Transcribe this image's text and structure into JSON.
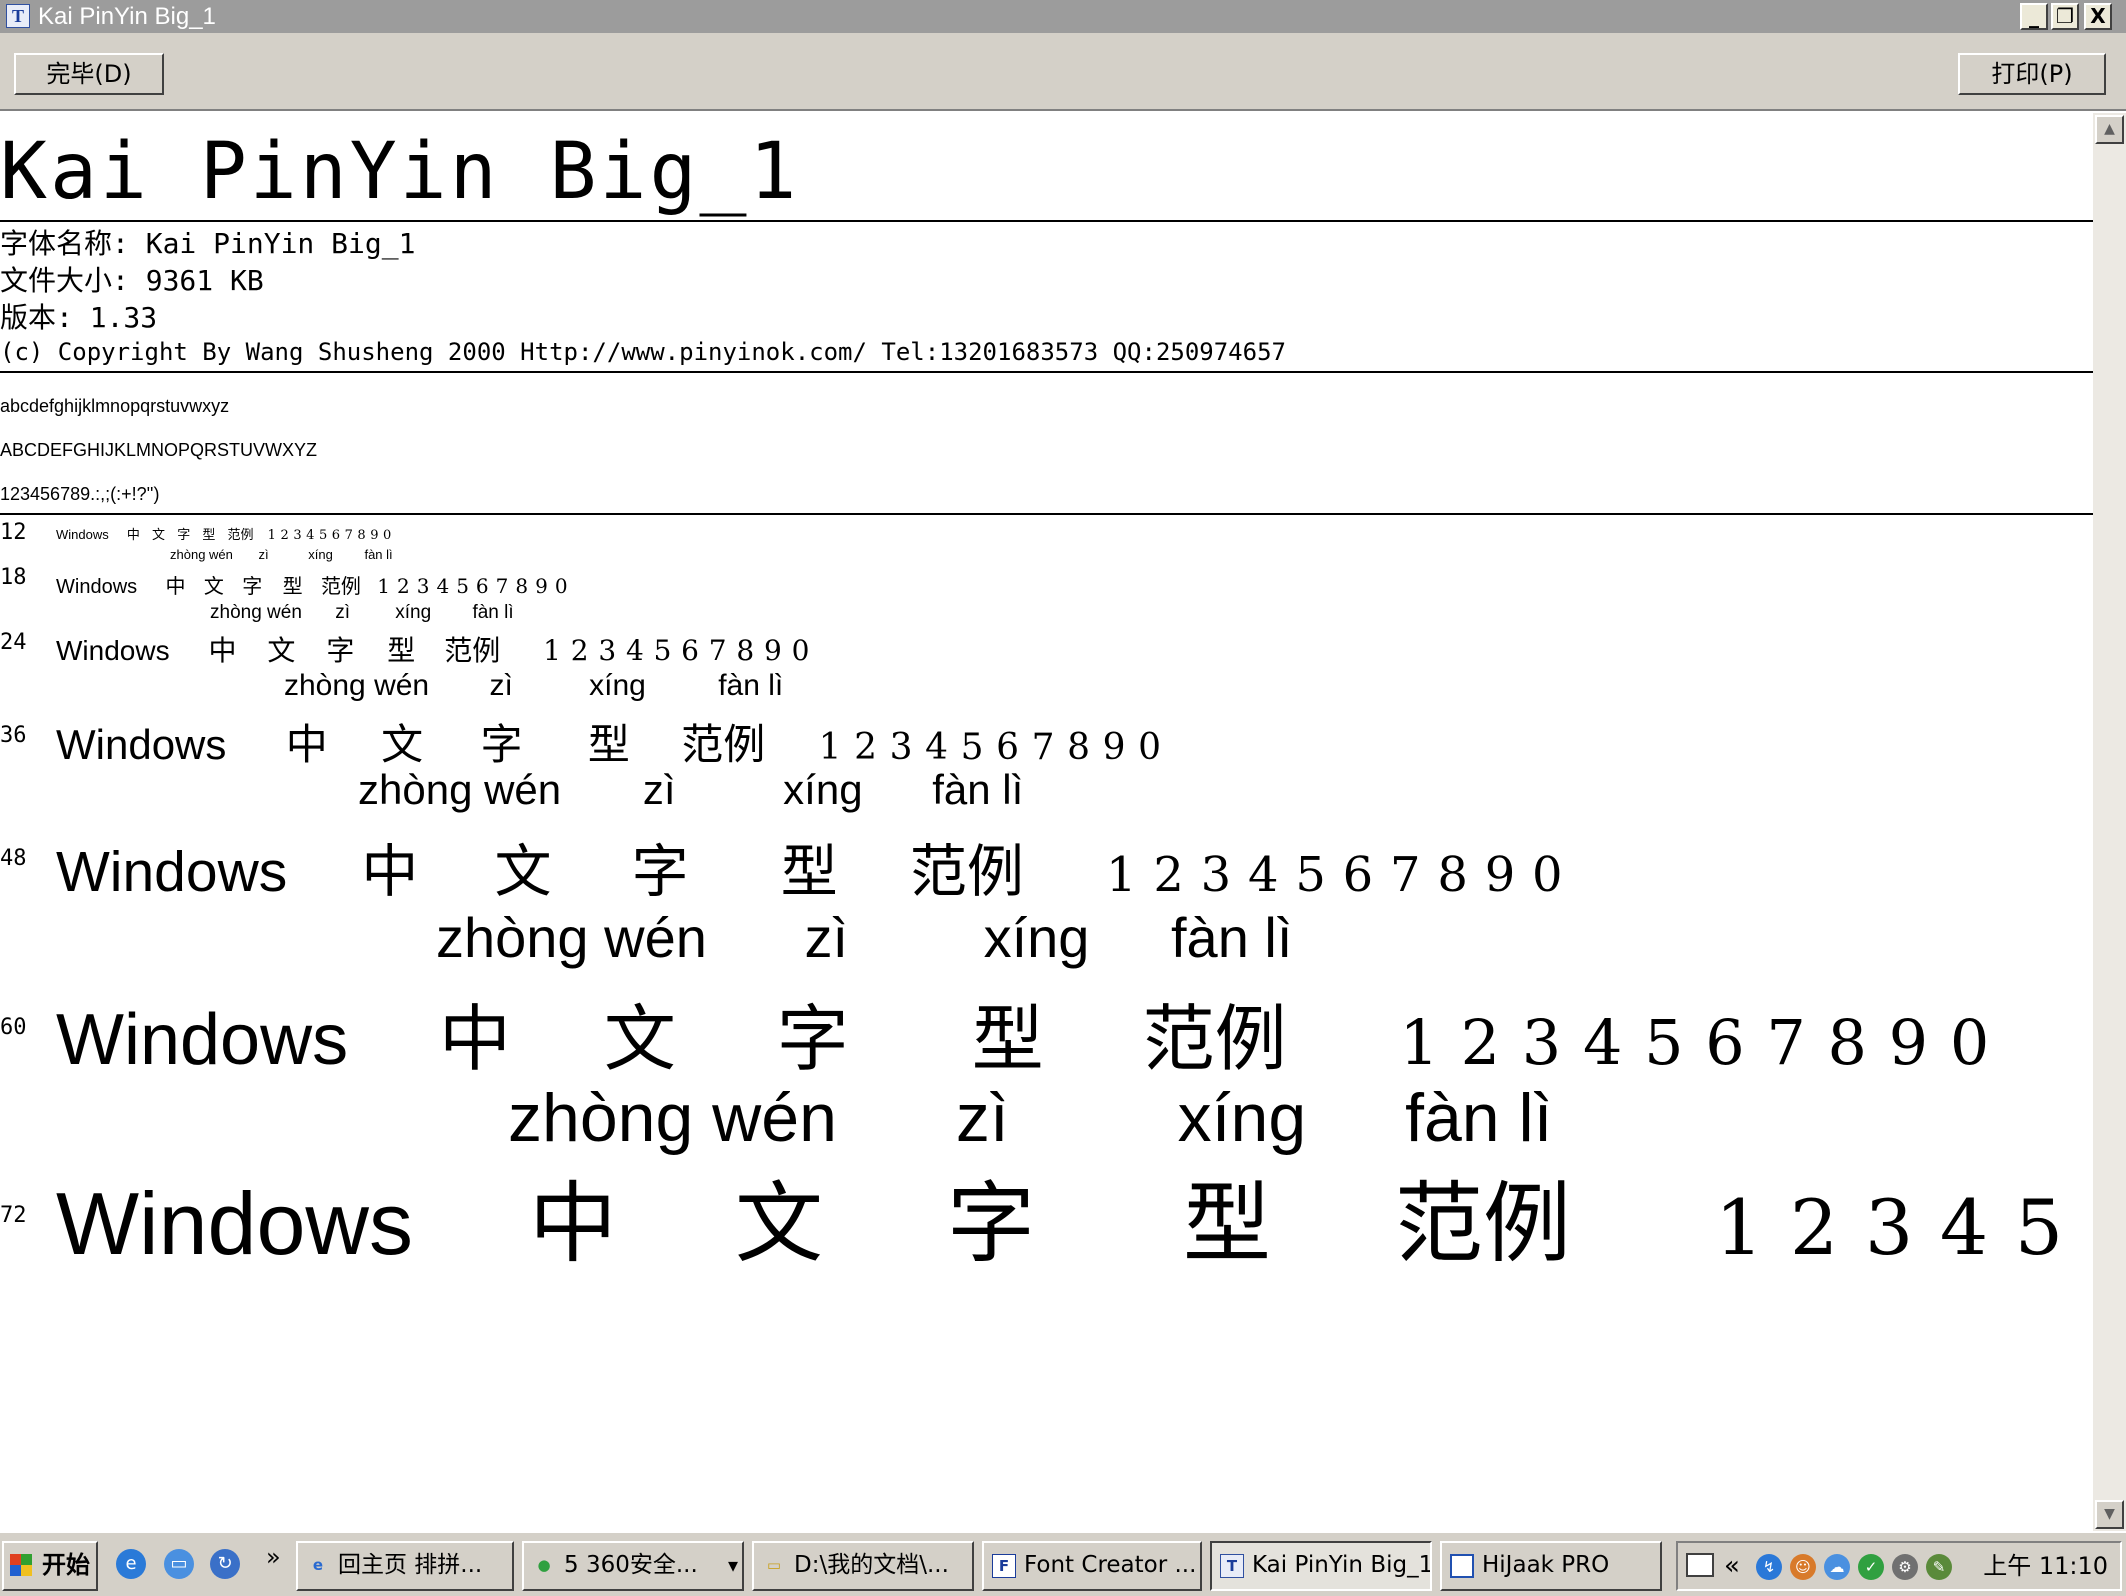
{
  "window": {
    "title": "Kai PinYin Big_1",
    "app_icon": "font-viewer-icon",
    "app_icon_glyph": "T",
    "controls": {
      "minimize": "_",
      "restore": "❐",
      "close": "X"
    }
  },
  "toolbar": {
    "done_label": "完毕(D)",
    "print_label": "打印(P)"
  },
  "font": {
    "display_name": "Kai PinYin Big_1",
    "name_line": "字体名称: Kai PinYin Big_1",
    "size_line": "文件大小: 9361 KB",
    "version_line": "版本: 1.33",
    "copyright_line": "(c) Copyright By Wang Shusheng 2000 Http://www.pinyinok.com/  Tel:13201683573  QQ:250974657"
  },
  "charsets": {
    "lowercase": "abcdefghijklmnopqrstuvwxyz",
    "uppercase": "ABCDEFGHIJKLMNOPQRSTUVWXYZ",
    "digits": "123456789.:,;(:+!?'')"
  },
  "sample": {
    "latin": "Windows",
    "hanzi": [
      "中",
      "文",
      "字",
      "型",
      "范例"
    ],
    "numbers": "1234567890",
    "pinyin": [
      "zhòng wén",
      "zì",
      "xíng",
      "fàn lì"
    ],
    "sizes": [
      "12",
      "18",
      "24",
      "36",
      "48",
      "60",
      "72"
    ]
  },
  "scrollbar": {
    "up": "▲",
    "down": "▼"
  },
  "taskbar": {
    "start_label": "开始",
    "quick_launch_more": "»",
    "tasks": [
      {
        "label": "回主页 排拼...",
        "icon": "ie-icon",
        "glyph": "e"
      },
      {
        "label": "5 360安全...",
        "icon": "360-icon",
        "glyph": "●",
        "dropdown": "▾"
      },
      {
        "label": "D:\\我的文档\\...",
        "icon": "folder-icon",
        "glyph": "▭"
      },
      {
        "label": "Font Creator ...",
        "icon": "font-creator-icon",
        "glyph": "F"
      },
      {
        "label": "Kai PinYin Big_1",
        "icon": "font-viewer-icon",
        "glyph": "T"
      },
      {
        "label": "HiJaak PRO",
        "icon": "hijaak-icon",
        "glyph": ""
      }
    ],
    "tray_expand": "«",
    "clock": "上午 11:10"
  }
}
